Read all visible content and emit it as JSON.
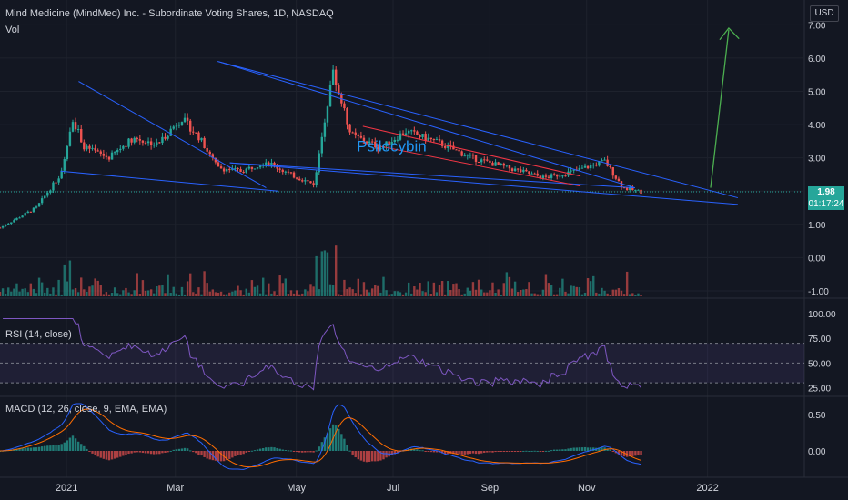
{
  "header": {
    "title": "Mind Medicine (MindMed) Inc. - Subordinate Voting Shares, 1D, NASDAQ",
    "vol_label": "Vol",
    "currency": "USD"
  },
  "price_badge": {
    "value": "1.98",
    "countdown": "01:17:24"
  },
  "annotation": "Psilocybin",
  "rsi_label": "RSI (14, close)",
  "macd_label": "MACD (12, 26, close, 9, EMA, EMA)",
  "colors": {
    "up": "#26a69a",
    "down": "#ef5350",
    "trend": "#2962ff",
    "channel": "#f23645",
    "arrow": "#4caf50",
    "rsi": "#7e57c2",
    "macd": "#2962ff",
    "signal": "#ff6d00",
    "bg": "#131722",
    "grid": "#1e222d",
    "annotation": "#2196f3"
  },
  "chart_data": [
    {
      "type": "candlestick",
      "title": "Mind Medicine (MindMed) Inc. - Subordinate Voting Shares, 1D, NASDAQ",
      "x_ticks": [
        "2021",
        "Mar",
        "May",
        "Jul",
        "Sep",
        "Nov",
        "2022"
      ],
      "y_ticks": [
        "7.00",
        "6.00",
        "5.00",
        "4.00",
        "3.00",
        "2.00",
        "1.00",
        "0.00",
        "-1.00"
      ],
      "ylim": [
        -1,
        7.2
      ],
      "last_price": 1.98,
      "close_path": [
        [
          0,
          0.9
        ],
        [
          0.06,
          1.5
        ],
        [
          0.1,
          2.5
        ],
        [
          0.12,
          4.2
        ],
        [
          0.14,
          3.3
        ],
        [
          0.18,
          3.0
        ],
        [
          0.22,
          3.6
        ],
        [
          0.26,
          3.4
        ],
        [
          0.3,
          4.2
        ],
        [
          0.33,
          3.6
        ],
        [
          0.36,
          2.7
        ],
        [
          0.4,
          2.6
        ],
        [
          0.44,
          2.9
        ],
        [
          0.48,
          2.5
        ],
        [
          0.52,
          2.2
        ],
        [
          0.55,
          5.6
        ],
        [
          0.58,
          3.7
        ],
        [
          0.63,
          3.3
        ],
        [
          0.67,
          3.8
        ],
        [
          0.72,
          3.5
        ],
        [
          0.78,
          3.0
        ],
        [
          0.84,
          2.7
        ],
        [
          0.9,
          2.4
        ],
        [
          0.95,
          2.6
        ],
        [
          1.0,
          2.9
        ],
        [
          1.03,
          2.1
        ],
        [
          1.06,
          1.98
        ]
      ],
      "trendlines": [
        {
          "name": "upper-1",
          "from": [
            0.13,
            5.3
          ],
          "to": [
            0.44,
            2.1
          ]
        },
        {
          "name": "lower-1",
          "from": [
            0.1,
            2.6
          ],
          "to": [
            0.46,
            2.0
          ]
        },
        {
          "name": "upper-2",
          "from": [
            0.36,
            5.9
          ],
          "to": [
            1.05,
            2.1
          ]
        },
        {
          "name": "lower-2",
          "from": [
            0.38,
            2.85
          ],
          "to": [
            1.05,
            2.1
          ]
        }
      ]
    },
    {
      "type": "bar",
      "name": "Vol",
      "note": "volume histogram"
    },
    {
      "type": "line",
      "name": "RSI (14, close)",
      "y_ticks": [
        "100.00",
        "75.00",
        "50.00",
        "25.00"
      ],
      "ylim": [
        20,
        100
      ],
      "bands": [
        30,
        70
      ]
    },
    {
      "type": "line",
      "name": "MACD (12, 26, close, 9, EMA, EMA)",
      "y_ticks": [
        "0.50",
        "0.00"
      ],
      "ylim": [
        -0.3,
        0.7
      ]
    }
  ]
}
